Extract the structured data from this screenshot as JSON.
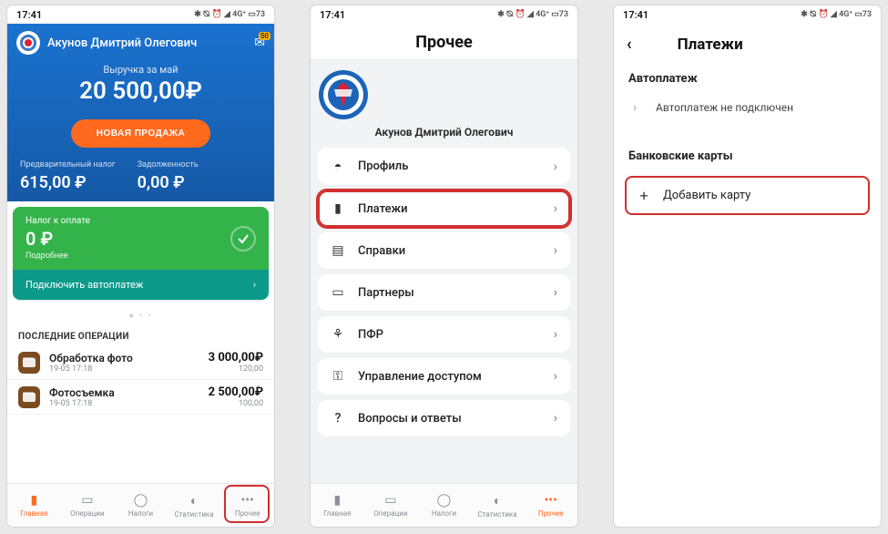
{
  "status": {
    "time": "17:41",
    "indicators": "✱ ⦰ ⏰ ◢ 4G⁺ ▭73"
  },
  "screen1": {
    "user_name": "Акунов Дмитрий Олегович",
    "mail_badge": "50",
    "revenue_label": "Выручка за май",
    "revenue_amount": "20 500,00₽",
    "new_sale_btn": "НОВАЯ ПРОДАЖА",
    "pretax_label": "Предварительный налог",
    "pretax_value": "615,00 ₽",
    "debt_label": "Задолженность",
    "debt_value": "0,00 ₽",
    "topay_label": "Налог к оплате",
    "topay_value": "0 ₽",
    "details": "Подробнее",
    "autopay_link": "Подключить автоплатеж",
    "last_ops_header": "ПОСЛЕДНИЕ ОПЕРАЦИИ",
    "ops": [
      {
        "title": "Обработка фото",
        "sub": "19-05 17:18",
        "amt": "3 000,00₽",
        "tax": "120,00"
      },
      {
        "title": "Фотосъемка",
        "sub": "19-05 17:18",
        "amt": "2 500,00₽",
        "tax": "100,00"
      }
    ],
    "nav": [
      "Главная",
      "Операции",
      "Налоги",
      "Статистика",
      "Прочее"
    ]
  },
  "screen2": {
    "title": "Прочее",
    "user_name": "Акунов Дмитрий Олегович",
    "items": [
      {
        "icon": "person",
        "label": "Профиль"
      },
      {
        "icon": "wallet",
        "label": "Платежи",
        "hl": true
      },
      {
        "icon": "doc",
        "label": "Справки"
      },
      {
        "icon": "brief",
        "label": "Партнеры"
      },
      {
        "icon": "pfr",
        "label": "ПФР"
      },
      {
        "icon": "key",
        "label": "Управление доступом"
      },
      {
        "icon": "help",
        "label": "Вопросы и ответы"
      }
    ],
    "nav": [
      "Главная",
      "Операции",
      "Налоги",
      "Статистика",
      "Прочее"
    ]
  },
  "screen3": {
    "title": "Платежи",
    "sec1": "Автоплатеж",
    "sec1_row": "Автоплатеж не подключен",
    "sec2": "Банковские карты",
    "add_card": "Добавить карту"
  }
}
